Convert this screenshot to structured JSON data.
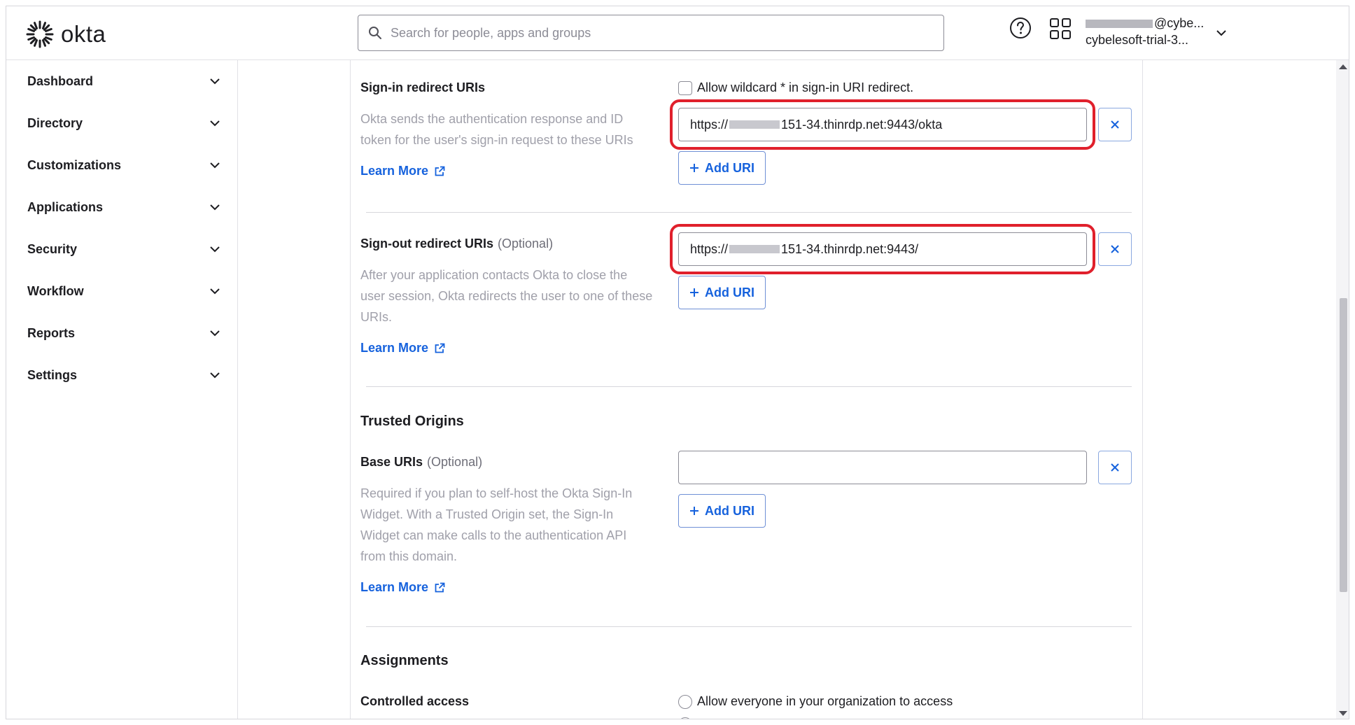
{
  "header": {
    "logo_text": "okta",
    "search_placeholder": "Search for people, apps and groups",
    "user_email_visible": "@cybe...",
    "user_org": "cybelesoft-trial-3..."
  },
  "sidebar": {
    "items": [
      {
        "label": "Dashboard"
      },
      {
        "label": "Directory"
      },
      {
        "label": "Customizations"
      },
      {
        "label": "Applications"
      },
      {
        "label": "Security"
      },
      {
        "label": "Workflow"
      },
      {
        "label": "Reports"
      },
      {
        "label": "Settings"
      }
    ]
  },
  "signin": {
    "label": "Sign-in redirect URIs",
    "wildcard_label": "Allow wildcard * in sign-in URI redirect.",
    "description": "Okta sends the authentication response and ID token for the user's sign-in request to these URIs",
    "learn_more": "Learn More",
    "uri_prefix": "https://",
    "uri_suffix": "151-34.thinrdp.net:9443/okta",
    "add_uri": "Add URI"
  },
  "signout": {
    "label": "Sign-out redirect URIs",
    "optional": "(Optional)",
    "description": "After your application contacts Okta to close the user session, Okta redirects the user to one of these URIs.",
    "learn_more": "Learn More",
    "uri_prefix": "https://",
    "uri_suffix": "151-34.thinrdp.net:9443/",
    "add_uri": "Add URI"
  },
  "trusted_origins": {
    "heading": "Trusted Origins",
    "label": "Base URIs",
    "optional": "(Optional)",
    "description": "Required if you plan to self-host the Okta Sign-In Widget. With a Trusted Origin set, the Sign-In Widget can make calls to the authentication API from this domain.",
    "learn_more": "Learn More",
    "value": "",
    "add_uri": "Add URI"
  },
  "assignments": {
    "heading": "Assignments",
    "controlled_access_label": "Controlled access",
    "option_everyone": "Allow everyone in your organization to access"
  },
  "colors": {
    "link": "#1662dd",
    "highlight": "#e0202c"
  }
}
